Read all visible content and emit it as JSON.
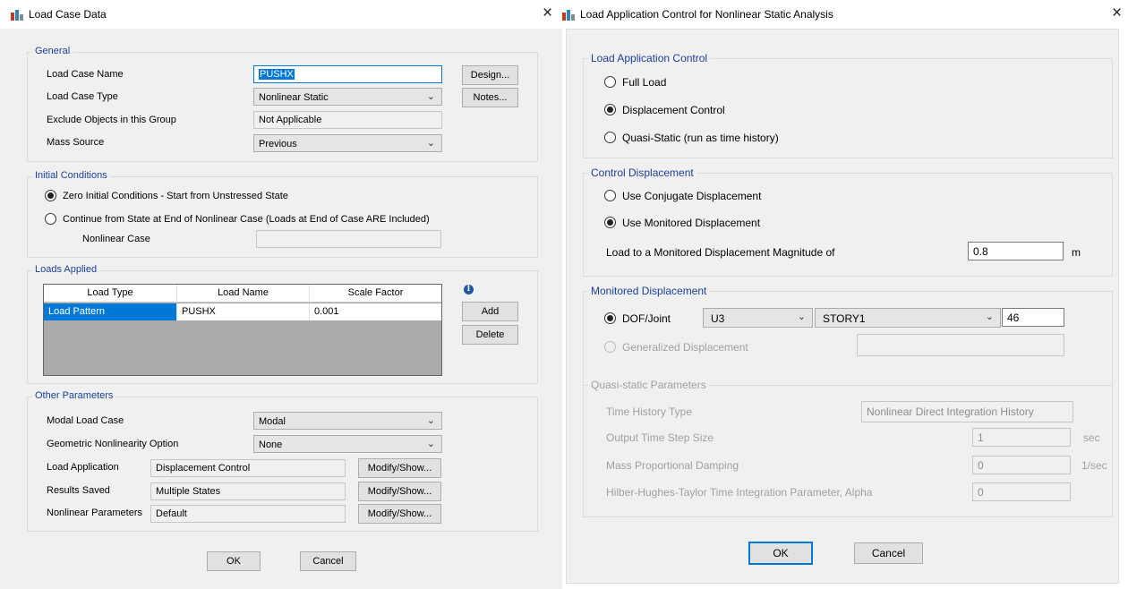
{
  "left_window": {
    "title": "Load Case Data",
    "icon": "etabs-app-icon",
    "general": {
      "legend": "General",
      "name_label": "Load Case Name",
      "name_value": "PUSHX",
      "type_label": "Load Case Type",
      "type_value": "Nonlinear Static",
      "exclude_label": "Exclude Objects in this Group",
      "exclude_value": "Not Applicable",
      "mass_label": "Mass Source",
      "mass_value": "Previous",
      "design_btn": "Design...",
      "notes_btn": "Notes..."
    },
    "initial": {
      "legend": "Initial Conditions",
      "zero_label": "Zero Initial Conditions - Start from Unstressed State",
      "continue_label": "Continue from State at End of Nonlinear Case  (Loads at End of Case ARE Included)",
      "nonlinear_case_label": "Nonlinear Case",
      "nonlinear_case_value": ""
    },
    "loads": {
      "legend": "Loads Applied",
      "columns": [
        "Load Type",
        "Load Name",
        "Scale Factor"
      ],
      "rows": [
        {
          "type": "Load Pattern",
          "name": "PUSHX",
          "scale": "0.001"
        }
      ],
      "add_btn": "Add",
      "delete_btn": "Delete"
    },
    "other": {
      "legend": "Other Parameters",
      "modal_label": "Modal Load Case",
      "modal_value": "Modal",
      "geom_label": "Geometric Nonlinearity Option",
      "geom_value": "None",
      "app_label": "Load Application",
      "app_value": "Displacement Control",
      "results_label": "Results Saved",
      "results_value": "Multiple States",
      "nl_label": "Nonlinear Parameters",
      "nl_value": "Default",
      "modify_btn": "Modify/Show..."
    },
    "ok_btn": "OK",
    "cancel_btn": "Cancel"
  },
  "right_window": {
    "title": "Load Application Control for Nonlinear Static Analysis",
    "control": {
      "legend": "Load Application Control",
      "full_load": "Full Load",
      "disp_control": "Displacement Control",
      "quasi_static": "Quasi-Static (run as time history)"
    },
    "control_disp": {
      "legend": "Control Displacement",
      "conjugate": "Use Conjugate Displacement",
      "monitored": "Use Monitored Displacement",
      "magnitude_label": "Load to a Monitored Displacement Magnitude of",
      "magnitude_value": "0.8",
      "unit": "m"
    },
    "monitored": {
      "legend": "Monitored Displacement",
      "dof_label": "DOF/Joint",
      "dof_value": "U3",
      "story_value": "STORY1",
      "joint_value": "46",
      "generalized_label": "Generalized Displacement",
      "generalized_value": ""
    },
    "quasi": {
      "legend": "Quasi-static Parameters",
      "history_label": "Time History Type",
      "history_value": "Nonlinear Direct Integration History",
      "step_label": "Output Time Step Size",
      "step_value": "1",
      "step_unit": "sec",
      "mass_label": "Mass Proportional Damping",
      "mass_value": "0",
      "mass_unit": "1/sec",
      "hht_label": "Hilber-Hughes-Taylor Time Integration Parameter, Alpha",
      "hht_value": "0"
    },
    "ok_btn": "OK",
    "cancel_btn": "Cancel"
  },
  "close_glyph": "×"
}
